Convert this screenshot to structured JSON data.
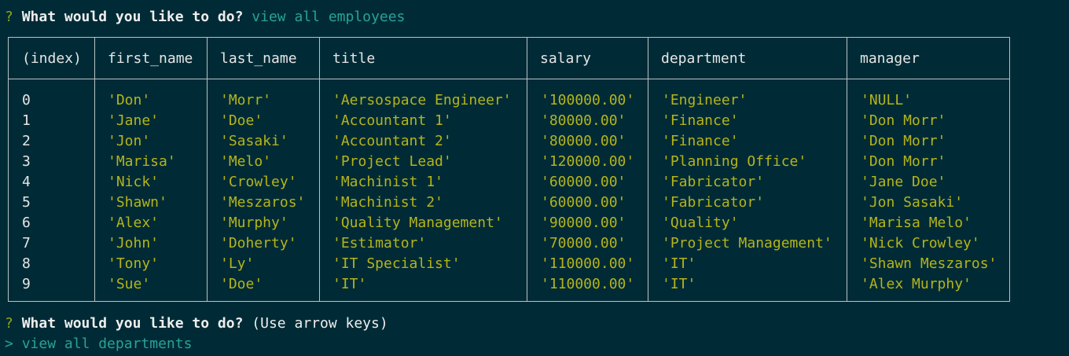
{
  "prompt1": {
    "marker": "?",
    "question": "What would you like to do?",
    "answer": "view all employees"
  },
  "table": {
    "headers": [
      "(index)",
      "first_name",
      "last_name",
      "title",
      "salary",
      "department",
      "manager"
    ],
    "index": [
      "0",
      "1",
      "2",
      "3",
      "4",
      "5",
      "6",
      "7",
      "8",
      "9"
    ],
    "first_name": [
      "'Don'",
      "'Jane'",
      "'Jon'",
      "'Marisa'",
      "'Nick'",
      "'Shawn'",
      "'Alex'",
      "'John'",
      "'Tony'",
      "'Sue'"
    ],
    "last_name": [
      "'Morr'",
      "'Doe'",
      "'Sasaki'",
      "'Melo'",
      "'Crowley'",
      "'Meszaros'",
      "'Murphy'",
      "'Doherty'",
      "'Ly'",
      "'Doe'"
    ],
    "title": [
      "'Aersospace Engineer'",
      "'Accountant 1'",
      "'Accountant 2'",
      "'Project Lead'",
      "'Machinist 1'",
      "'Machinist 2'",
      "'Quality Management'",
      "'Estimator'",
      "'IT Specialist'",
      "'IT'"
    ],
    "salary": [
      "'100000.00'",
      "'80000.00'",
      "'80000.00'",
      "'120000.00'",
      "'60000.00'",
      "'60000.00'",
      "'90000.00'",
      "'70000.00'",
      "'110000.00'",
      "'110000.00'"
    ],
    "department": [
      "'Engineer'",
      "'Finance'",
      "'Finance'",
      "'Planning Office'",
      "'Fabricator'",
      "'Fabricator'",
      "'Quality'",
      "'Project Management'",
      "'IT'",
      "'IT'"
    ],
    "manager": [
      "'NULL'",
      "'Don Morr'",
      "'Don Morr'",
      "'Don Morr'",
      "'Jane Doe'",
      "'Jon Sasaki'",
      "'Marisa Melo'",
      "'Nick Crowley'",
      "'Shawn Meszaros'",
      "'Alex Murphy'"
    ]
  },
  "prompt2": {
    "marker": "?",
    "question": "What would you like to do?",
    "hint": "(Use arrow keys)"
  },
  "menu": {
    "pointer": ">",
    "selected_item": "view all departments"
  },
  "colors": {
    "background": "#002b36",
    "answer": "#2aa198",
    "value": "#b5b41a",
    "marker": "#93a51a",
    "border": "#b9c2c4"
  }
}
